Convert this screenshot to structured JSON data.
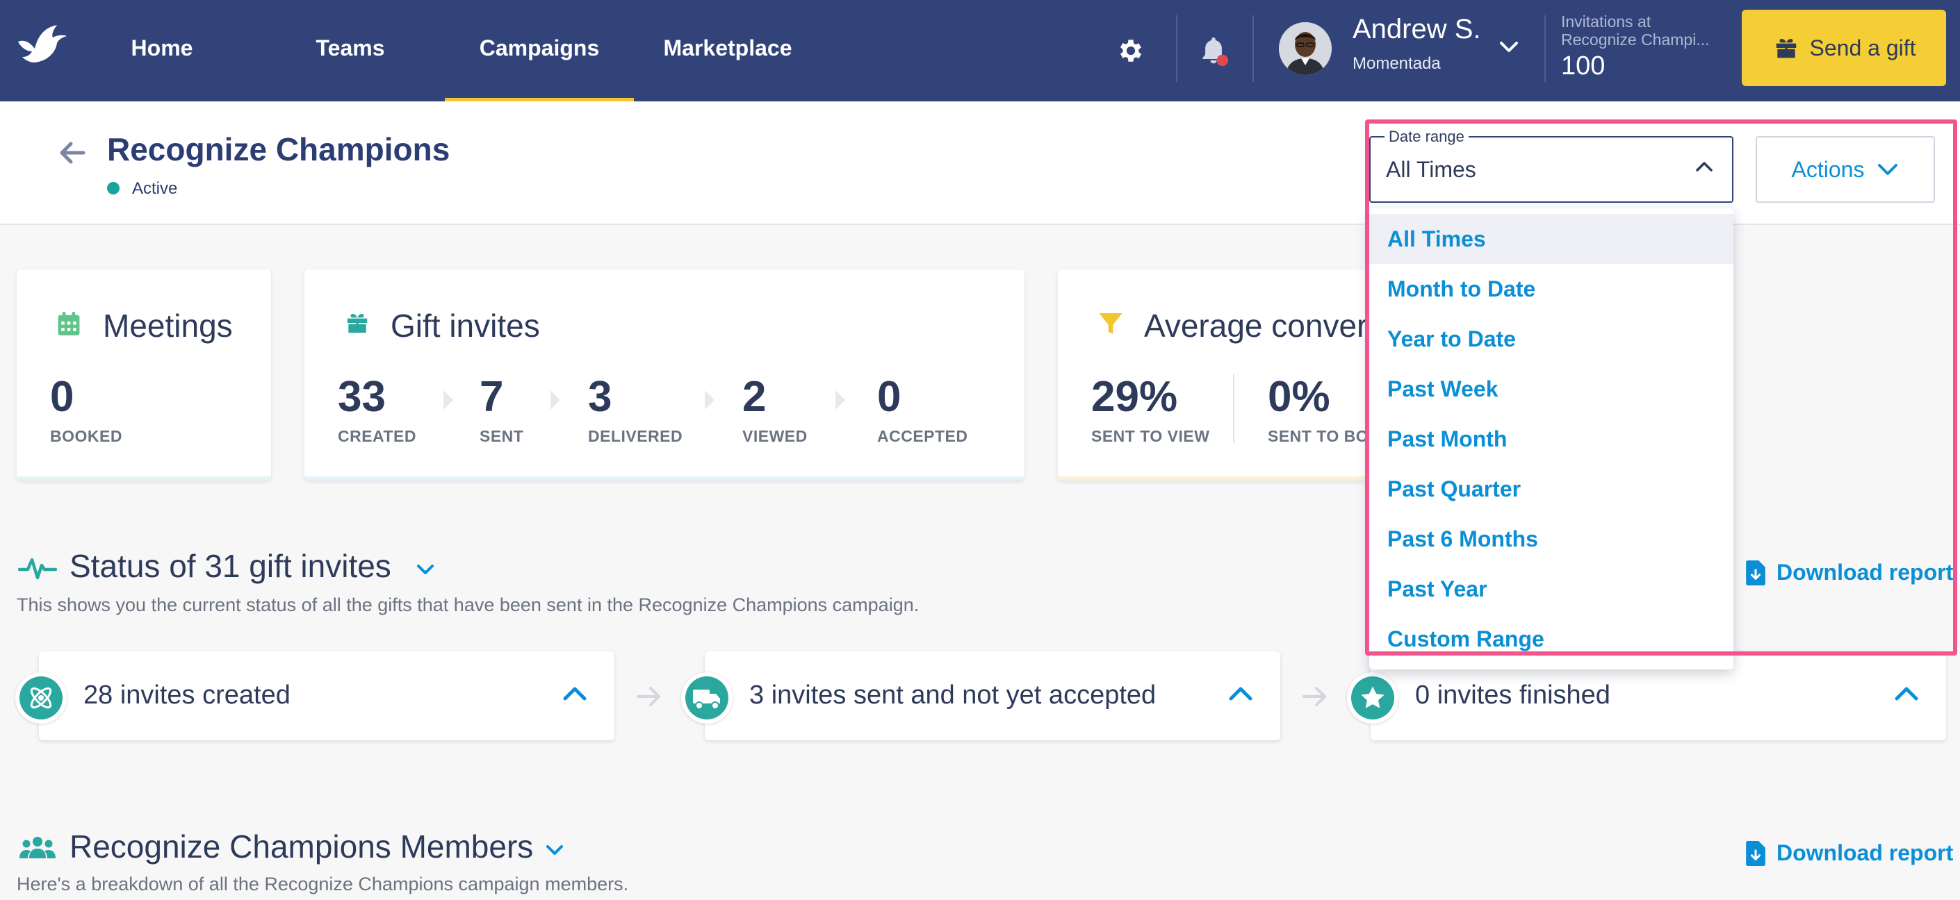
{
  "nav": {
    "links": [
      "Home",
      "Teams",
      "Campaigns",
      "Marketplace"
    ],
    "active": "Campaigns",
    "user_name": "Andrew S.",
    "user_org": "Momentada",
    "invitations_label": "Invitations at Recognize Champi...",
    "invitations_count": "100",
    "send_gift_label": "Send a gift",
    "icons": [
      "dove-logo-icon",
      "gear-icon",
      "bell-icon",
      "chevron-down-icon",
      "gift-icon"
    ],
    "colors": {
      "bar": "#32437a",
      "accent": "#f3c630",
      "notification": "#e5484d"
    }
  },
  "header": {
    "title": "Recognize Champions",
    "status": "Active",
    "date_range_legend": "Date range",
    "date_range_value": "All Times",
    "actions_label": "Actions"
  },
  "cards": {
    "meetings": {
      "title": "Meetings",
      "value": "0",
      "label": "BOOKED"
    },
    "gift_invites": {
      "title": "Gift invites",
      "stats": [
        {
          "value": "33",
          "label": "CREATED"
        },
        {
          "value": "7",
          "label": "SENT"
        },
        {
          "value": "3",
          "label": "DELIVERED"
        },
        {
          "value": "2",
          "label": "VIEWED"
        },
        {
          "value": "0",
          "label": "ACCEPTED"
        }
      ]
    },
    "conversion": {
      "title": "Average conver",
      "stats": [
        {
          "value": "29%",
          "label": "SENT TO VIEW"
        },
        {
          "value": "0%",
          "label": "SENT TO BO"
        }
      ]
    }
  },
  "status_section": {
    "title": "Status of 31 gift invites",
    "description": "This shows you the current status of all the gifts that have been sent in the Recognize Champions campaign.",
    "download_label": "Download report",
    "invites": [
      {
        "label": "28 invites created",
        "icon": "atom-icon"
      },
      {
        "label": "3 invites sent and not yet accepted",
        "icon": "truck-icon"
      },
      {
        "label": "0 invites finished",
        "icon": "star-icon"
      }
    ]
  },
  "members_section": {
    "title": "Recognize Champions Members",
    "description": "Here's a breakdown of all the Recognize Champions campaign members.",
    "download_label": "Download report"
  },
  "date_dropdown": {
    "selected": "All Times",
    "options": [
      "All Times",
      "Month to Date",
      "Year to Date",
      "Past Week",
      "Past Month",
      "Past Quarter",
      "Past 6 Months",
      "Past Year",
      "Custom Range"
    ],
    "highlight_color": "#f2558e"
  }
}
